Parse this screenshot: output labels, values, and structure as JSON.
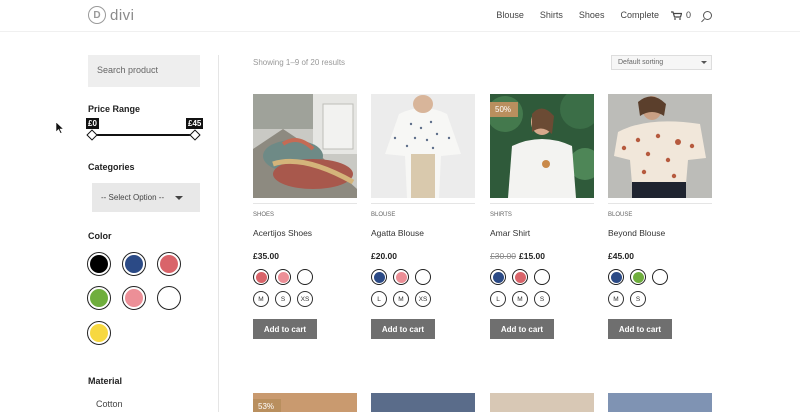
{
  "header": {
    "logo_mark": "D",
    "logo_text": "divi",
    "nav": [
      "Blouse",
      "Shirts",
      "Shoes",
      "Complete"
    ],
    "cart_count": "0"
  },
  "sidebar": {
    "search_placeholder": "Search product",
    "price_range_title": "Price Range",
    "price_min": "£0",
    "price_max": "£45",
    "categories_title": "Categories",
    "categories_select": "-- Select Option --",
    "color_title": "Color",
    "colors": [
      "#000000",
      "#2b4a86",
      "#d9646a",
      "#6fae3d",
      "#ec8f97",
      "#ffffff",
      "#f7d840"
    ],
    "material_title": "Material",
    "material_items": [
      "Cotton"
    ]
  },
  "results": {
    "count_text": "Showing 1–9 of 20 results",
    "sort_label": "Default sorting"
  },
  "products": [
    {
      "category": "SHOES",
      "name": "Acertijos Shoes",
      "price": "£35.00",
      "old_price": "",
      "badge": "",
      "swatches": [
        "#d9646a",
        "#ec8f97",
        "#ffffff"
      ],
      "sizes": [
        "M",
        "S",
        "XS"
      ],
      "button": "Add to cart"
    },
    {
      "category": "BLOUSE",
      "name": "Agatta Blouse",
      "price": "£20.00",
      "old_price": "",
      "badge": "",
      "swatches": [
        "#2b4a86",
        "#ec8f97",
        "#ffffff"
      ],
      "sizes": [
        "L",
        "M",
        "XS"
      ],
      "button": "Add to cart"
    },
    {
      "category": "SHIRTS",
      "name": "Amar Shirt",
      "price": "£15.00",
      "old_price": "£30.00",
      "badge": "50%",
      "swatches": [
        "#2b4a86",
        "#d9646a",
        "#ffffff"
      ],
      "sizes": [
        "L",
        "M",
        "S"
      ],
      "button": "Add to cart"
    },
    {
      "category": "BLOUSE",
      "name": "Beyond Blouse",
      "price": "£45.00",
      "old_price": "",
      "badge": "",
      "swatches": [
        "#2b4a86",
        "#6fae3d",
        "#ffffff"
      ],
      "sizes": [
        "M",
        "S"
      ],
      "button": "Add to cart"
    }
  ],
  "next_row": {
    "badge": "53%"
  }
}
